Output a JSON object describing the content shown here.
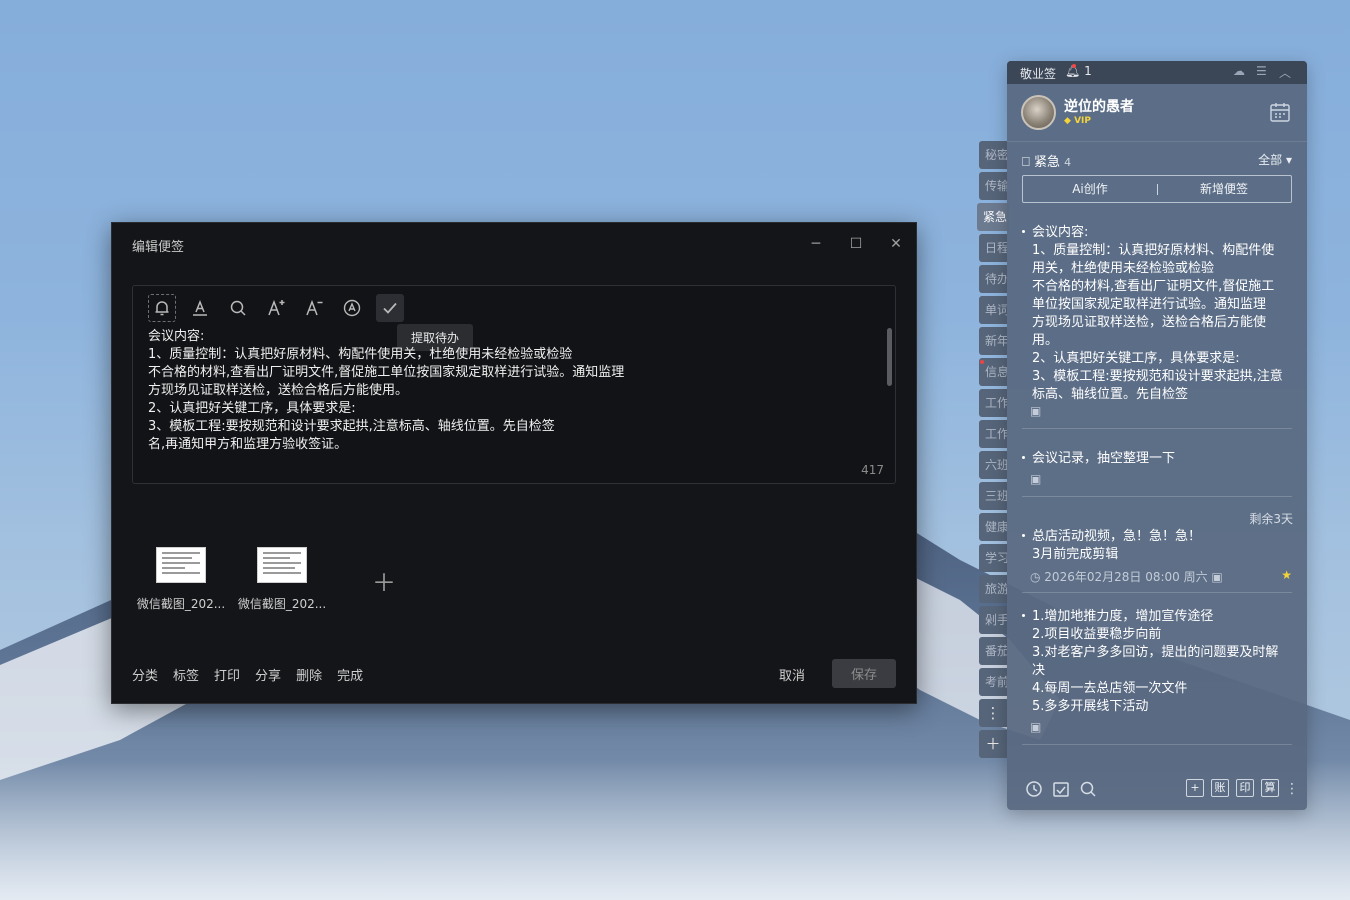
{
  "editor": {
    "title": "编辑便签",
    "tooltip": "提取待办",
    "content": "会议内容:\n1、质量控制：认真把好原材料、构配件使用关，杜绝使用未经检验或检验\n不合格的材料,查看出厂证明文件,督促施工单位按国家规定取样进行试验。通知监理\n方现场见证取样送检，送检合格后方能使用。\n2、认真把好关键工序，具体要求是:\n3、模板工程:要按规范和设计要求起拱,注意标高、轴线位置。先自检签\n名,再通知甲方和监理方验收签证。",
    "char_count": "417",
    "attachments": [
      {
        "name": "微信截图_202..."
      },
      {
        "name": "微信截图_202..."
      }
    ],
    "footer": [
      "分类",
      "标签",
      "打印",
      "分享",
      "删除",
      "完成"
    ],
    "cancel": "取消",
    "save": "保存"
  },
  "tabs": [
    "秘密",
    "传输",
    "紧急",
    "日程",
    "待办",
    "单词",
    "新年",
    "信息",
    "工作",
    "工作",
    "六班",
    "三班",
    "健康",
    "学习",
    "旅游",
    "剁手",
    "番茄",
    "考前"
  ],
  "panel": {
    "app": "敬业签",
    "bell_count": "1",
    "user": "逆位的愚者",
    "vip": "VIP",
    "category": "紧急",
    "category_count": "4",
    "filter": "全部",
    "ai_btn": "Ai创作",
    "new_btn": "新增便签",
    "notes": [
      {
        "text": "会议内容:\n1、质量控制：认真把好原材料、构配件使\n用关，杜绝使用未经检验或检验\n不合格的材料,查看出厂证明文件,督促施工\n单位按国家规定取样进行试验。通知监理\n方现场见证取样送检，送检合格后方能使\n用。\n2、认真把好关键工序，具体要求是:\n3、模板工程:要按规范和设计要求起拱,注意\n标高、轴线位置。先自检签"
      },
      {
        "text": "会议记录，抽空整理一下"
      },
      {
        "text": "总店活动视频，急！急！急！\n3月前完成剪辑",
        "date": "2026年02月28日 08:00 周六",
        "remain": "剩余3天"
      },
      {
        "text": "1.增加地推力度，增加宣传途径\n2.项目收益要稳步向前\n3.对老客户多多回访，提出的问题要及时解\n决\n4.每周一去总店领一次文件\n5.多多开展线下活动"
      }
    ],
    "footer_buttons": [
      "+",
      "账",
      "印",
      "算"
    ]
  },
  "colors": {
    "editor_bg": "#141518",
    "panel_bg": "#586880",
    "accent_star": "#f5d33b"
  }
}
